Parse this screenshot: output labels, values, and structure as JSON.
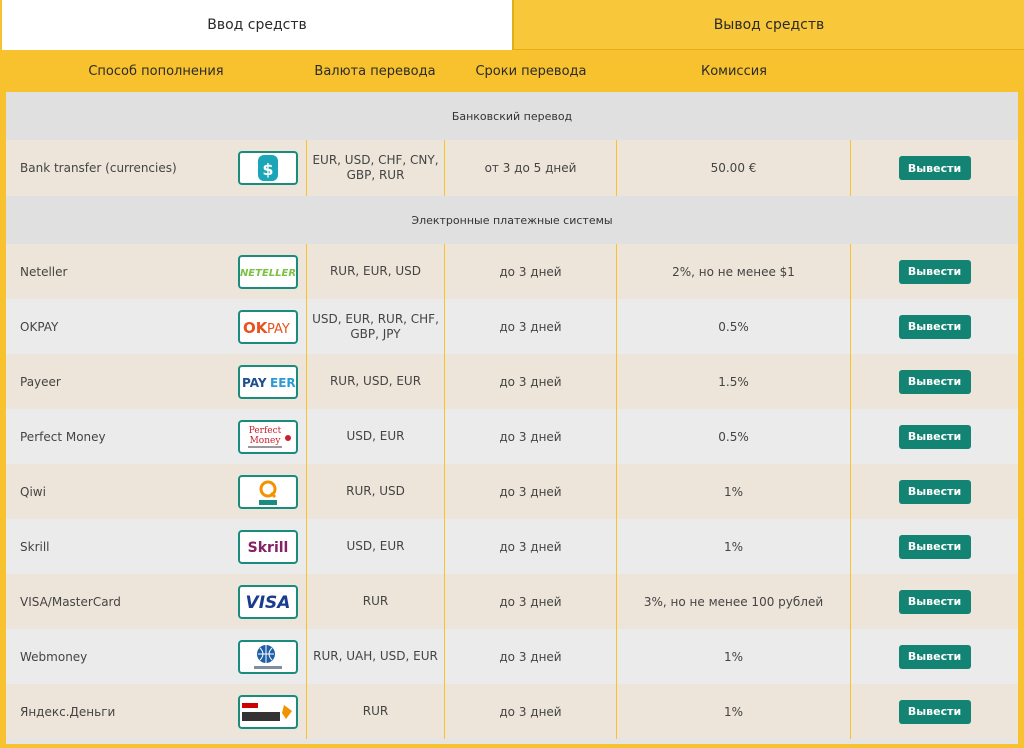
{
  "tabs": {
    "deposit": "Ввод средств",
    "withdraw": "Вывод средств"
  },
  "columns": {
    "method": "Способ пополнения",
    "currency": "Валюта перевода",
    "term": "Сроки перевода",
    "fee": "Комиссия"
  },
  "sections": {
    "bank": "Банковский перевод",
    "ewallets": "Электронные платежные системы"
  },
  "button_label": "Вывести",
  "bank_rows": [
    {
      "name": "Bank transfer (currencies)",
      "logo": "bank-transfer-logo-icon",
      "currency": "EUR, USD, CHF, CNY, GBP, RUR",
      "term": "от 3 до 5 дней",
      "fee": "50.00 €"
    }
  ],
  "ewallet_rows": [
    {
      "name": "Neteller",
      "logo": "neteller-logo-icon",
      "logo_text": "NETELLER",
      "currency": "RUR, EUR, USD",
      "term": "до 3 дней",
      "fee": "2%, но не менее $1"
    },
    {
      "name": "OKPAY",
      "logo": "okpay-logo-icon",
      "logo_text": "OKPAY",
      "currency": "USD, EUR, RUR, CHF, GBP, JPY",
      "term": "до 3 дней",
      "fee": "0.5%"
    },
    {
      "name": "Payeer",
      "logo": "payeer-logo-icon",
      "logo_text": "PAYEER",
      "currency": "RUR, USD, EUR",
      "term": "до 3 дней",
      "fee": "1.5%"
    },
    {
      "name": "Perfect Money",
      "logo": "perfect-money-logo-icon",
      "logo_text": "Perfect Money",
      "currency": "USD, EUR",
      "term": "до 3 дней",
      "fee": "0.5%"
    },
    {
      "name": "Qiwi",
      "logo": "qiwi-logo-icon",
      "logo_text": "QIWI",
      "currency": "RUR, USD",
      "term": "до 3 дней",
      "fee": "1%"
    },
    {
      "name": "Skrill",
      "logo": "skrill-logo-icon",
      "logo_text": "Skrill",
      "currency": "USD, EUR",
      "term": "до 3 дней",
      "fee": "1%"
    },
    {
      "name": "VISA/MasterCard",
      "logo": "visa-logo-icon",
      "logo_text": "VISA",
      "currency": "RUR",
      "term": "до 3 дней",
      "fee": "3%, но не менее 100 рублей"
    },
    {
      "name": "Webmoney",
      "logo": "webmoney-logo-icon",
      "logo_text": "WebMoney",
      "currency": "RUR, UAH, USD, EUR",
      "term": "до 3 дней",
      "fee": "1%"
    },
    {
      "name": "Яндекс.Деньги",
      "logo": "yandex-money-logo-icon",
      "logo_text": "Яндекс Деньги",
      "currency": "RUR",
      "term": "до 3 дней",
      "fee": "1%"
    }
  ],
  "colors": {
    "accent": "#f7c22e",
    "button": "#138473",
    "row_beige": "#ede5d9",
    "row_grey": "#ebebeb"
  }
}
